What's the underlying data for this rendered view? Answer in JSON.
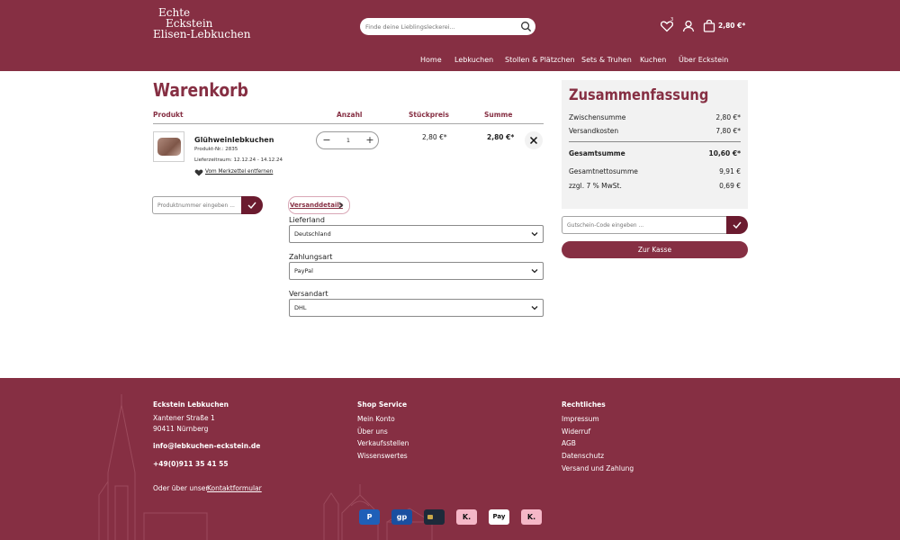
{
  "header": {
    "logo": [
      "Echte",
      "Eckstein",
      "Elisen-Lebkuchen"
    ],
    "search_placeholder": "Finde deine Lieblingsleckerei...",
    "wishlist_count": "3",
    "cart_total": "2,80 €*",
    "nav": [
      "Home",
      "Lebkuchen",
      "Stollen & Plätzchen",
      "Sets & Truhen",
      "Kuchen",
      "Über Eckstein"
    ]
  },
  "cart": {
    "title": "Warenkorb",
    "columns": {
      "product": "Produkt",
      "qty": "Anzahl",
      "unit": "Stückpreis",
      "sum": "Summe"
    },
    "item": {
      "name": "Glühweinlebkuchen",
      "sku": "Produkt-Nr.: 2835",
      "delivery": "Lieferzeitraum: 12.12.24 - 14.12.24",
      "remove_label": "Vom Merkzettel entfernen",
      "quantity": "1",
      "unit_price": "2,80 €*",
      "total": "2,80 €*"
    },
    "product_number_placeholder": "Produktnummer eingeben ...",
    "shipping": {
      "details_label": "Versanddetails",
      "country_label": "Lieferland",
      "country_value": "Deutschland",
      "payment_label": "Zahlungsart",
      "payment_value": "PayPal",
      "method_label": "Versandart",
      "method_value": "DHL"
    }
  },
  "summary": {
    "title": "Zusammenfassung",
    "subtotal_label": "Zwischensumme",
    "subtotal": "2,80 €*",
    "shipping_label": "Versandkosten",
    "shipping": "7,80 €*",
    "total_label": "Gesamtsumme",
    "total": "10,60 €*",
    "net_label": "Gesamtnettosumme",
    "net": "9,91 €",
    "vat_label": "zzgl. 7 % MwSt.",
    "vat": "0,69 €",
    "voucher_placeholder": "Gutschein-Code eingeben ...",
    "checkout_label": "Zur Kasse"
  },
  "footer": {
    "col1_title": "Eckstein Lebkuchen",
    "street": "Xantener Straße 1",
    "city": "90411 Nürnberg",
    "email": "info@lebkuchen-eckstein.de",
    "phone": "+49(0)911 35 41 55",
    "contact_prefix": "Oder über unser",
    "contact_link": "Kontaktformular",
    "col2_title": "Shop Service",
    "col2_links": [
      "Mein Konto",
      "Über uns",
      "Verkaufsstellen",
      "Wissenswertes"
    ],
    "col3_title": "Rechtliches",
    "col3_links": [
      "Impressum",
      "Widerruf",
      "AGB",
      "Datenschutz",
      "Versand und Zahlung"
    ],
    "payments": [
      {
        "name": "paypal-icon",
        "label": "P",
        "bg": "#1f5fb8",
        "fg": "#ffffff"
      },
      {
        "name": "giropay-icon",
        "label": "gp",
        "bg": "#1a4fa0",
        "fg": "#ffffff"
      },
      {
        "name": "credit-card-icon",
        "label": "",
        "bg": "#1d2a3a",
        "fg": "#ffffff"
      },
      {
        "name": "klarna-icon",
        "label": "K.",
        "bg": "#f5b7c7",
        "fg": "#111111"
      },
      {
        "name": "apple-pay-icon",
        "label": "Pay",
        "bg": "#ffffff",
        "fg": "#111111"
      },
      {
        "name": "klarna-icon-2",
        "label": "K.",
        "bg": "#f5b7c7",
        "fg": "#111111"
      }
    ]
  }
}
